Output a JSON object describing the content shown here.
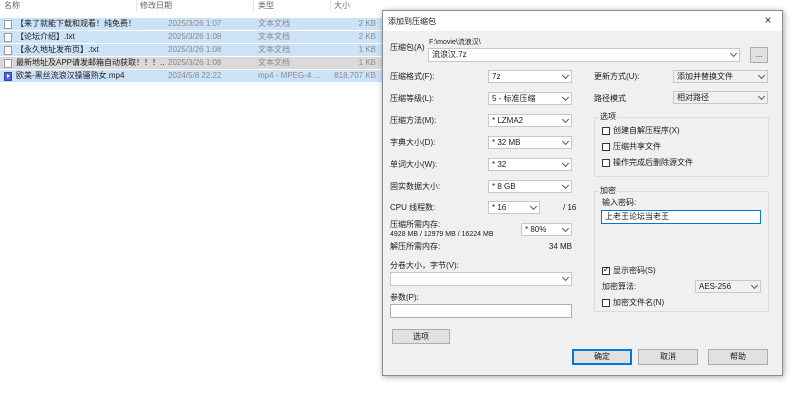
{
  "explorer": {
    "columns": {
      "name": "名称",
      "modified": "修改日期",
      "type": "类型",
      "size": "大小"
    },
    "files": [
      {
        "name": "【来了就能下载和观看！纯免费！】.txt",
        "date": "2025/3/26 1:07",
        "type": "文本文档",
        "size": "2 KB",
        "icon": "text-file-icon"
      },
      {
        "name": "【论坛介绍】.txt",
        "date": "2025/3/26 1:08",
        "type": "文本文档",
        "size": "2 KB",
        "icon": "text-file-icon"
      },
      {
        "name": "【永久地址发布页】.txt",
        "date": "2025/3/26 1:08",
        "type": "文本文档",
        "size": "1 KB",
        "icon": "text-file-icon"
      },
      {
        "name": "最新地址及APP请发邮箱自动获取！！！....",
        "date": "2025/3/26 1:08",
        "type": "文本文档",
        "size": "1 KB",
        "icon": "text-file-icon"
      },
      {
        "name": "欧美-黑丝流浪汉操骚熟女.mp4",
        "date": "2024/5/8 22:22",
        "type": "mp4 - MPEG-4 ...",
        "size": "818,707 KB",
        "icon": "video-file-icon"
      }
    ]
  },
  "dialog": {
    "title": "添加到压缩包",
    "close": "×",
    "archive_label": "压缩包(A)",
    "archive_path": "F:\\movie\\流浪汉\\",
    "archive_name": "流浪汉.7z",
    "browse": "...",
    "format_label": "压缩格式(F):",
    "format_value": "7z",
    "level_label": "压缩等级(L):",
    "level_value": "5 - 标准压缩",
    "method_label": "压缩方法(M):",
    "method_value": "* LZMA2",
    "dict_label": "字典大小(D):",
    "dict_value": "* 32 MB",
    "word_label": "单词大小(W):",
    "word_value": "* 32",
    "solid_label": "固实数据大小:",
    "solid_value": "* 8 GB",
    "threads_label": "CPU 线程数:",
    "threads_value": "* 16",
    "threads_total": "/ 16",
    "mem_comp_label": "压缩所需内存:",
    "mem_comp_detail": "4928 MB / 12979 MB / 16224 MB",
    "mem_percent": "* 80%",
    "mem_decomp_label": "解压所需内存:",
    "mem_decomp_value": "34 MB",
    "volume_label": "分卷大小，字节(V):",
    "params_label": "参数(P):",
    "options_button": "选项",
    "update_label": "更新方式(U):",
    "update_value": "添加并替换文件",
    "pathmode_label": "路径模式",
    "pathmode_value": "相对路径",
    "options_group": {
      "title": "选项",
      "items": [
        {
          "label": "创建自解压程序(X)",
          "checked": false
        },
        {
          "label": "压缩共享文件",
          "checked": false
        },
        {
          "label": "操作完成后删除源文件",
          "checked": false
        }
      ]
    },
    "encrypt_group": {
      "title": "加密",
      "password_label": "输入密码:",
      "password_value": "上老王论坛当老王",
      "show_password": "显示密码(S)",
      "method_label": "加密算法:",
      "method_value": "AES-256",
      "encrypt_names": "加密文件名(N)"
    },
    "ok": "确定",
    "cancel": "取消",
    "help": "帮助"
  },
  "colors": {
    "selection": "#cce3f7",
    "accent": "#0078d7"
  }
}
